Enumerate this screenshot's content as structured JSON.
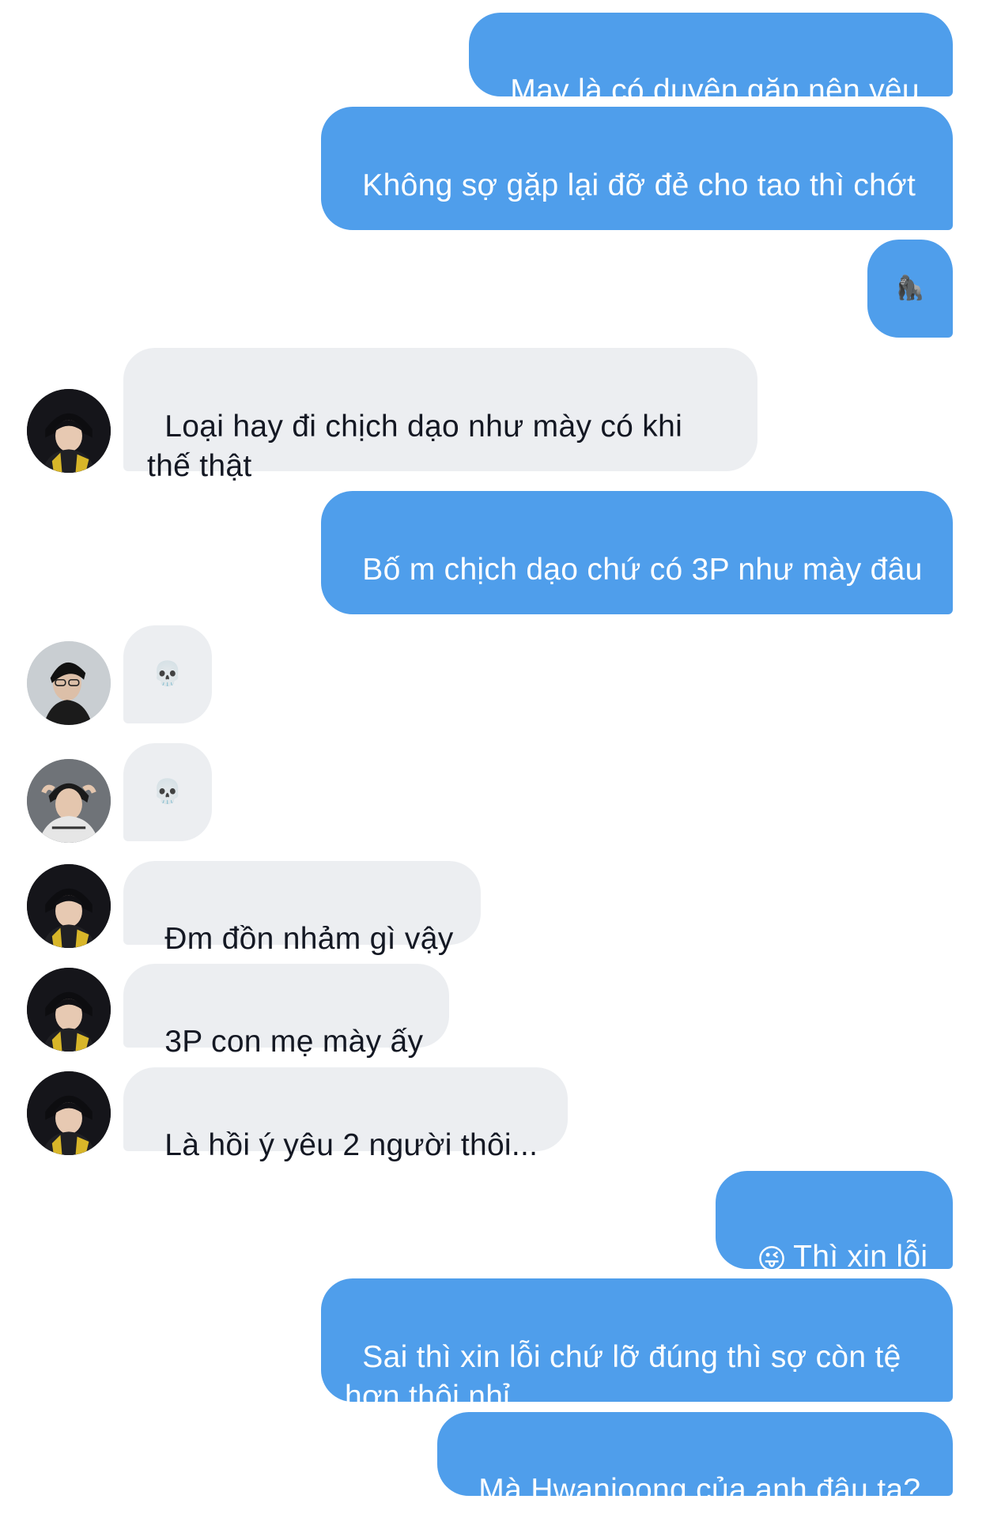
{
  "messages": [
    {
      "text": "May là có duyên gặp nên yêu"
    },
    {
      "text": "Không sợ gặp lại đỡ đẻ cho tao thì chớt"
    },
    {
      "emoji": "🦍",
      "icon": "gorilla-emoji"
    },
    {
      "text": "Loại hay đi chịch dạo như mày có khi thế thật"
    },
    {
      "text": "Bố m chịch dạo chứ có 3P như mày đâu"
    },
    {
      "emoji": "💀",
      "icon": "skull-emoji"
    },
    {
      "emoji": "💀",
      "icon": "skull-emoji"
    },
    {
      "text": "Đm đồn nhảm gì vậy"
    },
    {
      "text": "3P con mẹ mày ấy"
    },
    {
      "text": "Là hồi ý yêu 2 người thôi..."
    },
    {
      "emoji": "😜",
      "icon": "winking-tongue-emoji",
      "text": "Thì xin lỗi"
    },
    {
      "text": "Sai thì xin lỗi chứ lỡ đúng thì sợ còn tệ hơn thôi nhỉ"
    },
    {
      "text": "Mà Hwanjoong của anh đâu ta?"
    }
  ],
  "colors": {
    "outgoing_bubble": "#4f9eeb",
    "incoming_bubble": "#eceef1",
    "outgoing_text": "#ffffff",
    "incoming_text": "#141823"
  }
}
